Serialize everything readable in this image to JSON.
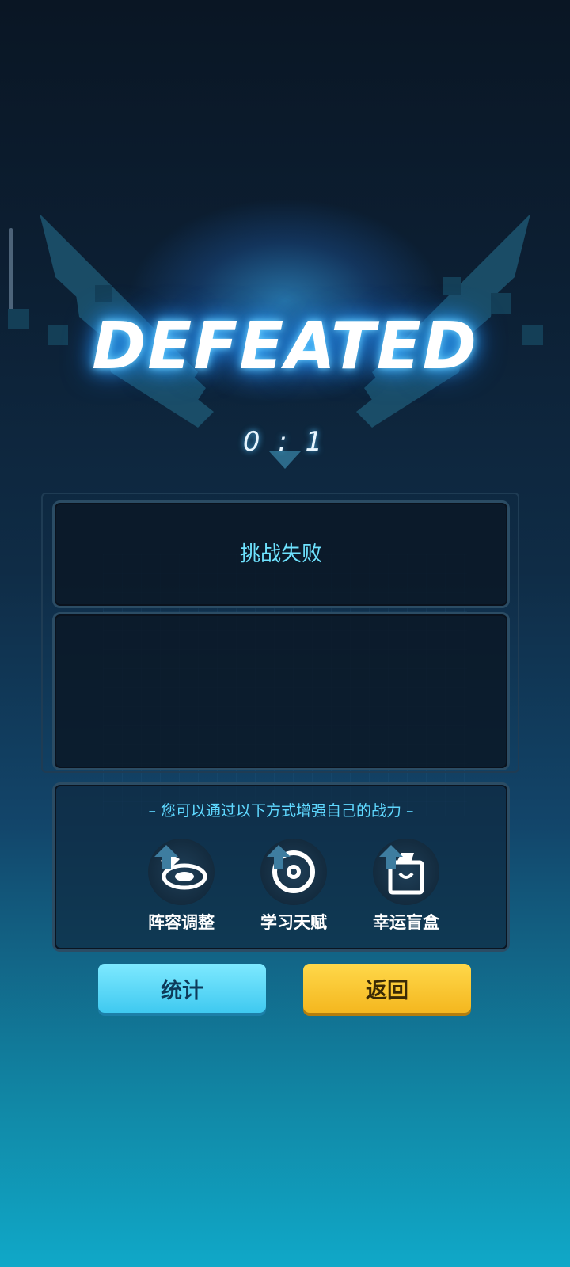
{
  "result": {
    "title": "DEFEATED",
    "score": "0 : 1"
  },
  "panels": {
    "status_text": "挑战失败",
    "hint_text": "– 您可以通过以下方式增强自己的战力 –"
  },
  "options": [
    {
      "label": "阵容调整",
      "icon": "lineup-icon"
    },
    {
      "label": "学习天赋",
      "icon": "talent-icon"
    },
    {
      "label": "幸运盲盒",
      "icon": "shopping-bag-icon"
    }
  ],
  "buttons": {
    "stats_label": "统计",
    "back_label": "返回"
  },
  "colors": {
    "accent_cyan": "#6fe3ff",
    "button_cyan": "#3fc9f0",
    "button_yellow": "#f4b71f"
  }
}
